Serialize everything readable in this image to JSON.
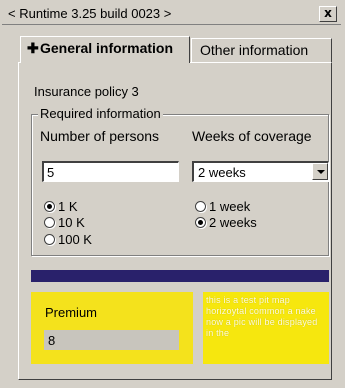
{
  "window": {
    "title": "< Runtime 3.25 build 0023 >",
    "close_label": "x"
  },
  "tabs": [
    {
      "label": "General information",
      "icon": "plus-icon",
      "active": true
    },
    {
      "label": "Other information",
      "active": false
    }
  ],
  "general": {
    "policy_label": "Insurance policy 3",
    "group_title": "Required information",
    "persons_header": "Number of persons",
    "weeks_header": "Weeks of coverage",
    "persons_value": "5",
    "weeks_selected": "2 weeks",
    "amount_options": [
      {
        "label": "1 K",
        "checked": true
      },
      {
        "label": "10 K",
        "checked": false
      },
      {
        "label": "100 K",
        "checked": false
      }
    ],
    "week_options": [
      {
        "label": "1 week",
        "checked": false
      },
      {
        "label": "2 weeks",
        "checked": true
      }
    ]
  },
  "premium": {
    "label": "Premium",
    "value": "8"
  },
  "picture": {
    "text": "this is a test pit map horizoytal common a nake now a pic will be displayed in the"
  },
  "colors": {
    "bar": "#29216b",
    "premium_bg": "#f4e21c",
    "picture_bg": "#f6e70e",
    "window_bg": "#d4d0c8"
  }
}
